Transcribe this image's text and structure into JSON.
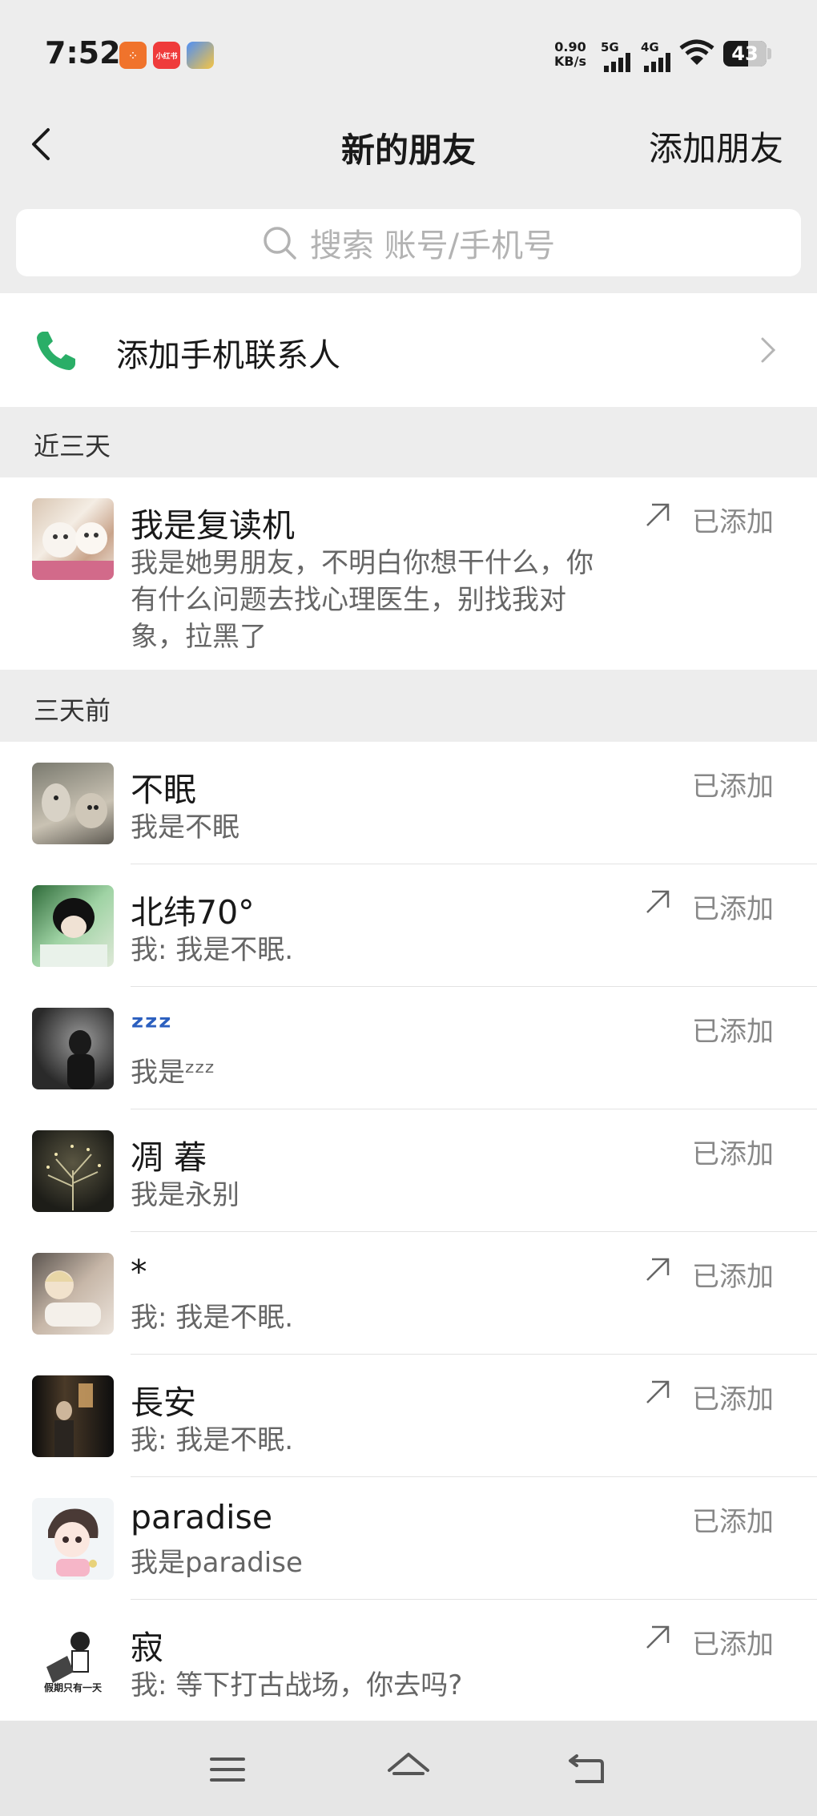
{
  "status_bar": {
    "time": "7:52",
    "app_icons": [
      "app-icon-orange",
      "小红书",
      "app-icon-blue"
    ],
    "net_speed_value": "0.90",
    "net_speed_unit": "KB/s",
    "signal1_label": "5G",
    "signal2_label": "4G",
    "battery": "43"
  },
  "header": {
    "title": "新的朋友",
    "right_action": "添加朋友"
  },
  "search": {
    "placeholder": "搜索 账号/手机号"
  },
  "add_contacts": {
    "label": "添加手机联系人"
  },
  "sections": [
    {
      "label": "近三天"
    },
    {
      "label": "三天前"
    }
  ],
  "recent": [
    {
      "name": "我是复读机",
      "message": "我是她男朋友，不明白你想干什么，你有什么问题去找心理医生，别找我对象，拉黑了",
      "status": "已添加",
      "arrow": true
    }
  ],
  "earlier": [
    {
      "name": "不眠",
      "message": "我是不眠",
      "status": "已添加",
      "arrow": false
    },
    {
      "name": "北纬70°",
      "message": "我: 我是不眠.",
      "status": "已添加",
      "arrow": true
    },
    {
      "name": "ᶻᶻᶻ",
      "message": "我是ᶻᶻᶻ",
      "status": "已添加",
      "arrow": false
    },
    {
      "name": "凋 萶",
      "message": "我是永别",
      "status": "已添加",
      "arrow": false
    },
    {
      "name": "*",
      "message": "我: 我是不眠.",
      "status": "已添加",
      "arrow": true
    },
    {
      "name": "長安",
      "message": "我: 我是不眠.",
      "status": "已添加",
      "arrow": true
    },
    {
      "name": "paradise",
      "message": "我是paradise",
      "status": "已添加",
      "arrow": false
    },
    {
      "name": "寂",
      "message": "我: 等下打古战场，你去吗?",
      "status": "已添加",
      "arrow": true,
      "avatar_caption": "假期只有一天"
    }
  ],
  "nav": [
    "menu-icon",
    "home-icon",
    "back-icon"
  ]
}
